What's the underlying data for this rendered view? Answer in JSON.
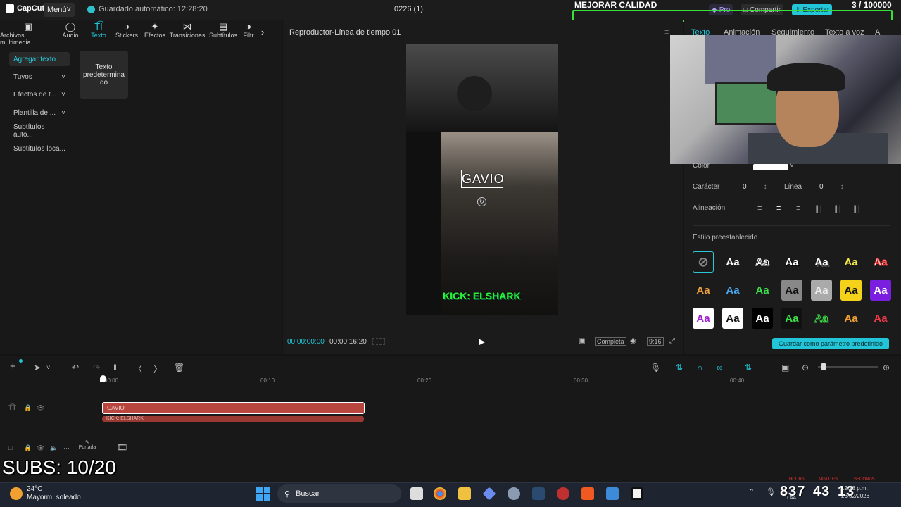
{
  "app": {
    "name": "CapCut",
    "menu_label": "Menú",
    "autosave": "Guardado automático: 12:28:20",
    "project_title": "0226 (1)",
    "pro_label": "Pro",
    "share_label": "Compartir",
    "export_label": "Exportar"
  },
  "overlay": {
    "title": "MEJORAR CALIDAD",
    "counter": "3 / 100000",
    "subs": "SUBS: 10/20"
  },
  "media_tabs": [
    {
      "label": "Archivos multimedia",
      "icon": "media-icon"
    },
    {
      "label": "Audio",
      "icon": "audio-icon"
    },
    {
      "label": "Texto",
      "icon": "text-icon"
    },
    {
      "label": "Stickers",
      "icon": "sticker-icon"
    },
    {
      "label": "Efectos",
      "icon": "effects-icon"
    },
    {
      "label": "Transiciones",
      "icon": "transition-icon"
    },
    {
      "label": "Subtítulos",
      "icon": "captions-icon"
    },
    {
      "label": "Filtr",
      "icon": "filter-icon"
    }
  ],
  "sidebar": [
    {
      "label": "Agregar texto"
    },
    {
      "label": "Tuyos"
    },
    {
      "label": "Efectos de t..."
    },
    {
      "label": "Plantilla de ..."
    },
    {
      "label": "Subtítulos auto..."
    },
    {
      "label": "Subtítulos loca..."
    }
  ],
  "preset_card": "Texto predetermina do",
  "player": {
    "title": "Reproductor-Línea de tiempo 01",
    "selected_text": "GAVIO",
    "kick_text": "KICK: ELSHARK",
    "current_time": "00:00:00:00",
    "duration": "00:00:16:20",
    "complete_label": "Completa",
    "ratio_label": "9:16"
  },
  "inspector": {
    "tabs": [
      "Texto",
      "Animación",
      "Seguimiento",
      "Texto a voz",
      "A"
    ],
    "color_label": "Color",
    "char_label": "Carácter",
    "char_value": "0",
    "line_label": "Línea",
    "line_value": "0",
    "align_label": "Alineación",
    "preset_label": "Estilo preestablecido",
    "save_label": "Guardar como parámetro predefinido",
    "style_glyph": "Aa"
  },
  "timeline": {
    "ruler": [
      "00:00",
      "00:10",
      "00:20",
      "00:30",
      "00:40"
    ],
    "clip1": "GAVIO",
    "clip2": "KICK: ELSHARK",
    "cover_label": "Portada"
  },
  "taskbar": {
    "temp": "24°C",
    "weather": "Mayorm. soleado",
    "search": "Buscar",
    "clock_h": "8",
    "clock_m": "37",
    "clock_s": "43",
    "clock_x": "13",
    "hours_lbl": "HOURS",
    "min_lbl": "MINUTES",
    "sec_lbl": "SECONDS",
    "sys_time": "12:28 p.m.",
    "sys_date": "26/02/2026",
    "lang": "LAA"
  }
}
